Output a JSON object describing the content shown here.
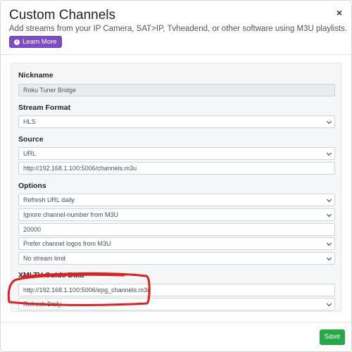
{
  "header": {
    "title": "Custom Channels",
    "close_glyph": "×",
    "subtitle": "Add streams from your IP Camera, SAT>IP, Tvheadend, or other software using M3U playlists.",
    "learn_more_label": "Learn More"
  },
  "form": {
    "nickname": {
      "label": "Nickname",
      "value": "Roku Tuner Bridge"
    },
    "stream_format": {
      "label": "Stream Format",
      "value": "HLS"
    },
    "source": {
      "label": "Source",
      "type_value": "URL",
      "url_value": "http://192.168.1.100:5006/channels.m3u"
    },
    "options": {
      "label": "Options",
      "refresh_value": "Refresh URL daily",
      "channel_number_value": "Ignore channel-number from M3U",
      "start_number_value": "20000",
      "logos_value": "Prefer channel logos from M3U",
      "stream_limit_value": "No stream limit"
    },
    "xmltv": {
      "label": "XMLTV Guide Data",
      "url_value": "http://192.168.1.100:5006/epg_channels.m3u",
      "refresh_value": "Refresh Daily"
    }
  },
  "footer": {
    "save_label": "Save"
  },
  "colors": {
    "learn_more_bg": "#7c4dc4",
    "save_bg": "#28a745",
    "annotation_red": "#e02020"
  },
  "icons": {
    "learn_more": "info-circle-icon",
    "close": "close-icon"
  }
}
